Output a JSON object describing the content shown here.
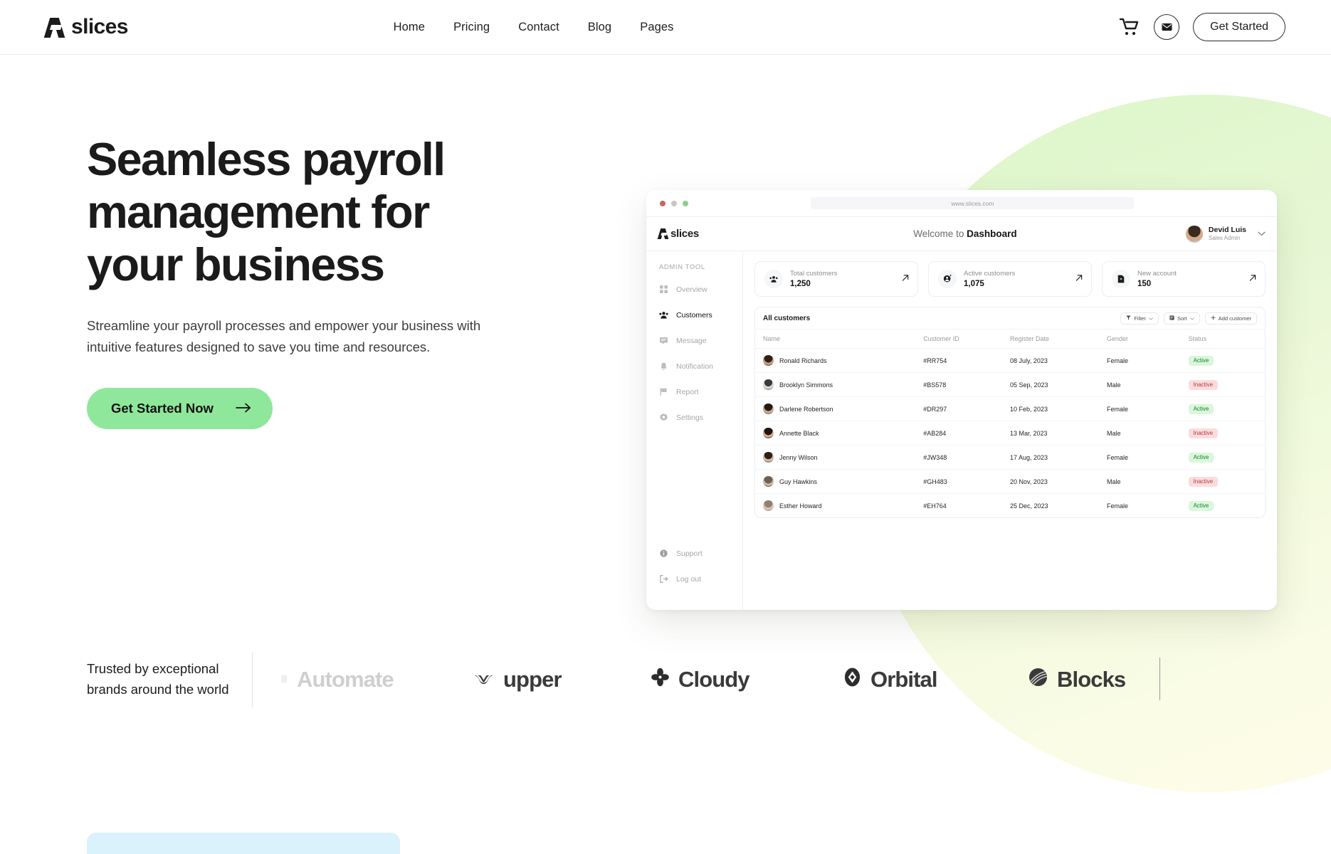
{
  "brand": {
    "name": "slices"
  },
  "nav": {
    "menu": [
      {
        "label": "Home"
      },
      {
        "label": "Pricing"
      },
      {
        "label": "Contact"
      },
      {
        "label": "Blog"
      },
      {
        "label": "Pages"
      }
    ],
    "cart_icon": "shopping-cart-icon",
    "mail_icon": "envelope-icon",
    "cta_label": "Get Started"
  },
  "hero": {
    "title_line1": "Seamless payroll",
    "title_line2": "management for",
    "title_line3": "your business",
    "subtitle": "Streamline your payroll processes and empower your business with intuitive features designed to save you time and resources.",
    "cta_label": "Get Started Now",
    "cta_icon": "arrow-right-icon",
    "cta_color": "#8fe79b"
  },
  "dashboard": {
    "browser": {
      "url": "www.slices.com",
      "dot_colors": [
        "#c1695c",
        "#c9c5c0",
        "#8ccf87"
      ]
    },
    "logo_text": "slices",
    "welcome_prefix": "Welcome to ",
    "welcome_bold": "Dashboard",
    "profile": {
      "name": "Devid Luis",
      "role": "Sales Admin",
      "chevron": "chevron-down-icon"
    },
    "sidebar": {
      "section_title": "ADMIN TOOL",
      "items": [
        {
          "label": "Overview",
          "icon": "grid-icon",
          "active": false
        },
        {
          "label": "Customers",
          "icon": "users-icon",
          "active": true
        },
        {
          "label": "Message",
          "icon": "chat-icon",
          "active": false
        },
        {
          "label": "Notification",
          "icon": "bell-icon",
          "active": false
        },
        {
          "label": "Report",
          "icon": "flag-icon",
          "active": false
        },
        {
          "label": "Settings",
          "icon": "gear-icon",
          "active": false
        }
      ],
      "bottom_items": [
        {
          "label": "Support",
          "icon": "info-icon"
        },
        {
          "label": "Log out",
          "icon": "logout-icon"
        }
      ]
    },
    "stats": [
      {
        "label": "Total customers",
        "value": "1,250",
        "icon": "users-icon",
        "arrow": "arrow-up-right-icon"
      },
      {
        "label": "Active customers",
        "value": "1,075",
        "icon": "user-check-icon",
        "arrow": "arrow-up-right-icon"
      },
      {
        "label": "New account",
        "value": "150",
        "icon": "file-plus-icon",
        "arrow": "arrow-up-right-icon"
      }
    ],
    "table": {
      "title": "All customers",
      "actions": [
        {
          "label": "Filter",
          "icon": "filter-icon",
          "chevron": true
        },
        {
          "label": "Sort",
          "icon": "sort-icon",
          "chevron": true
        },
        {
          "label": "Add customer",
          "icon": "plus-icon",
          "chevron": false
        }
      ],
      "columns": [
        "Name",
        "Customer ID",
        "Register Date",
        "Gender",
        "Status"
      ],
      "rows": [
        {
          "name": "Ronald Richards",
          "id": "#RR754",
          "date": "08 July, 2023",
          "gender": "Female",
          "status": "Active"
        },
        {
          "name": "Brooklyn Simmons",
          "id": "#BS578",
          "date": "05 Sep, 2023",
          "gender": "Male",
          "status": "Inactive"
        },
        {
          "name": "Darlene Robertson",
          "id": "#DR297",
          "date": "10 Feb, 2023",
          "gender": "Female",
          "status": "Active"
        },
        {
          "name": "Annette Black",
          "id": "#AB284",
          "date": "13 Mar, 2023",
          "gender": "Male",
          "status": "Inactive"
        },
        {
          "name": "Jenny Wilson",
          "id": "#JW348",
          "date": "17 Aug, 2023",
          "gender": "Female",
          "status": "Active"
        },
        {
          "name": "Guy Hawkins",
          "id": "#GH483",
          "date": "20 Nov, 2023",
          "gender": "Male",
          "status": "Inactive"
        },
        {
          "name": "Esther Howard",
          "id": "#EH764",
          "date": "25 Dec, 2023",
          "gender": "Female",
          "status": "Active"
        }
      ]
    }
  },
  "brands": {
    "label": "Trusted by exceptional brands around the world",
    "logos": [
      {
        "name": "Automate",
        "icon": "automate-icon",
        "faded": true
      },
      {
        "name": "upper",
        "icon": "upper-icon",
        "faded": false
      },
      {
        "name": "Cloudy",
        "icon": "cloudy-icon",
        "faded": false
      },
      {
        "name": "Orbital",
        "icon": "orbital-icon",
        "faded": false
      },
      {
        "name": "Blocks",
        "icon": "blocks-icon",
        "faded": false
      }
    ]
  },
  "decor": {
    "blob_color": "#e4f7d2",
    "bottom_card_color": "#d9f2fc"
  }
}
